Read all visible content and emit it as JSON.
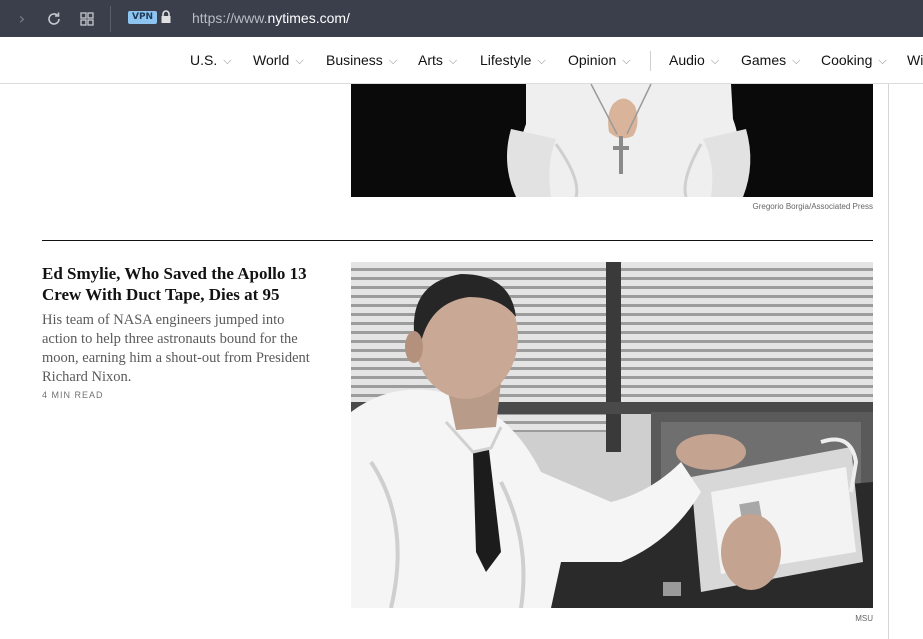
{
  "browser": {
    "vpn_label": "VPN",
    "url_prefix": "https://www.",
    "url_host": "nytimes.com",
    "url_suffix": "/"
  },
  "nav": {
    "items": [
      {
        "label": "U.S."
      },
      {
        "label": "World"
      },
      {
        "label": "Business"
      },
      {
        "label": "Arts"
      },
      {
        "label": "Lifestyle"
      },
      {
        "label": "Opinion"
      },
      {
        "label": "Audio"
      },
      {
        "label": "Games"
      },
      {
        "label": "Cooking"
      },
      {
        "label": "Wi"
      }
    ]
  },
  "top_image": {
    "credit": "Gregorio Borgia/Associated Press"
  },
  "article": {
    "headline": "Ed Smylie, Who Saved the Apollo 13 Crew With Duct Tape, Dies at 95",
    "summary": "His team of NASA engineers jumped into action to help three astronauts bound for the moon, earning him a shout-out from President Richard Nixon.",
    "read_time": "4 MIN READ",
    "image_credit": "MSU"
  },
  "icons": {
    "forward": "chevron-right-icon",
    "reload": "reload-icon",
    "tabs": "grid-icon",
    "lock": "lock-icon",
    "nav_chevron": "chevron-down-icon"
  }
}
